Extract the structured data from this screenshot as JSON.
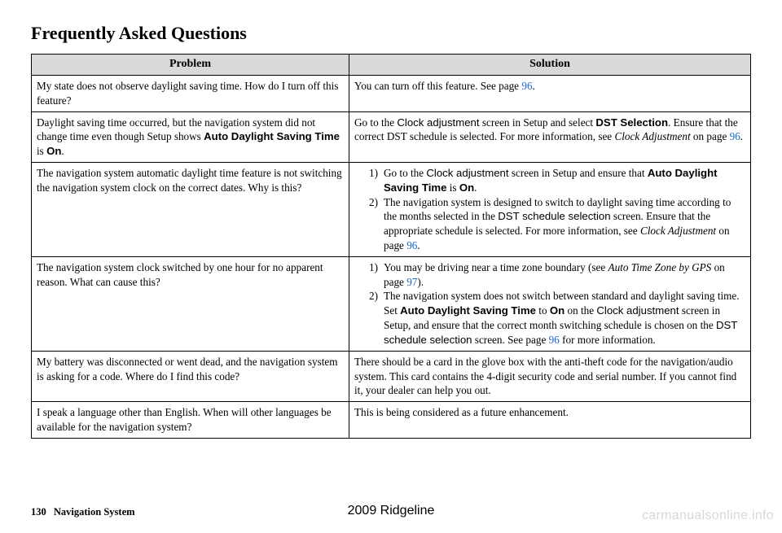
{
  "page": {
    "title": "Frequently Asked Questions",
    "number": "130",
    "section": "Navigation System",
    "model": "2009  Ridgeline",
    "watermark": "carmanualsonline.info"
  },
  "table": {
    "headers": {
      "problem": "Problem",
      "solution": "Solution"
    },
    "rows": {
      "r1": {
        "problem": "My state does not observe daylight saving time. How do I turn off this feature?",
        "solution_pre": "You can turn off this feature. See page ",
        "solution_link": "96",
        "solution_post": "."
      },
      "r2": {
        "problem_a": "Daylight saving time occurred, but the navigation system did not change time even though Setup shows ",
        "problem_b_sans": "Auto Daylight Saving Time",
        "problem_c": " is ",
        "problem_d_sans": "On",
        "problem_e": ".",
        "sol_a": "Go to the ",
        "sol_b_sans": "Clock adjustment",
        "sol_c": " screen in Setup and select ",
        "sol_d_sansb": "DST Selection",
        "sol_e": ". Ensure that the correct DST schedule is selected. For more information, see ",
        "sol_f_it": "Clock Adjustment",
        "sol_g": " on page ",
        "sol_link": "96",
        "sol_h": "."
      },
      "r3": {
        "problem": "The navigation system automatic daylight time feature is not switching the navigation system clock on the correct dates. Why is this?",
        "li1_num": "1)",
        "li1_a": "Go to the ",
        "li1_b_sans": "Clock adjustment",
        "li1_c": " screen in Setup and ensure that ",
        "li1_d_sansb": "Auto Daylight Saving Time",
        "li1_e": " is ",
        "li1_f_sansb": "On",
        "li1_g": ".",
        "li2_num": "2)",
        "li2_a": "The navigation system is designed to switch to daylight saving time according to the months selected in the ",
        "li2_b_sans": "DST schedule selection",
        "li2_c": " screen. Ensure that the appropriate schedule is selected. For more information, see ",
        "li2_d_it": "Clock Adjustment",
        "li2_e": " on page ",
        "li2_link": "96",
        "li2_f": "."
      },
      "r4": {
        "problem": "The navigation system clock switched by one hour for no apparent reason. What can cause this?",
        "li1_num": "1)",
        "li1_a": "You may be driving near a time zone boundary (see ",
        "li1_b_it": "Auto Time Zone by GPS",
        "li1_c": " on page ",
        "li1_link": "97",
        "li1_d": ").",
        "li2_num": "2)",
        "li2_a": "The navigation system does not switch between standard and daylight saving time. Set ",
        "li2_b_sansb": "Auto Daylight Saving Time",
        "li2_c": " to ",
        "li2_d_sansb": "On",
        "li2_e": " on the ",
        "li2_f_sans": "Clock adjustment",
        "li2_g": " screen in Setup, and ensure that the correct month switching schedule is chosen on the ",
        "li2_h_sans": "DST schedule selection",
        "li2_i": " screen. See page ",
        "li2_link": "96",
        "li2_j": " for more information."
      },
      "r5": {
        "problem": "My battery was disconnected or went dead, and the navigation system is asking for a code. Where do I find this code?",
        "solution": "There should be a card in the glove box with the anti-theft code for the navigation/audio system. This card contains the 4-digit security code and serial number. If you cannot find it, your dealer can help you out."
      },
      "r6": {
        "problem": "I speak a language other than English. When will other languages be available for the navigation system?",
        "solution": "This is being considered as a future enhancement."
      }
    }
  }
}
